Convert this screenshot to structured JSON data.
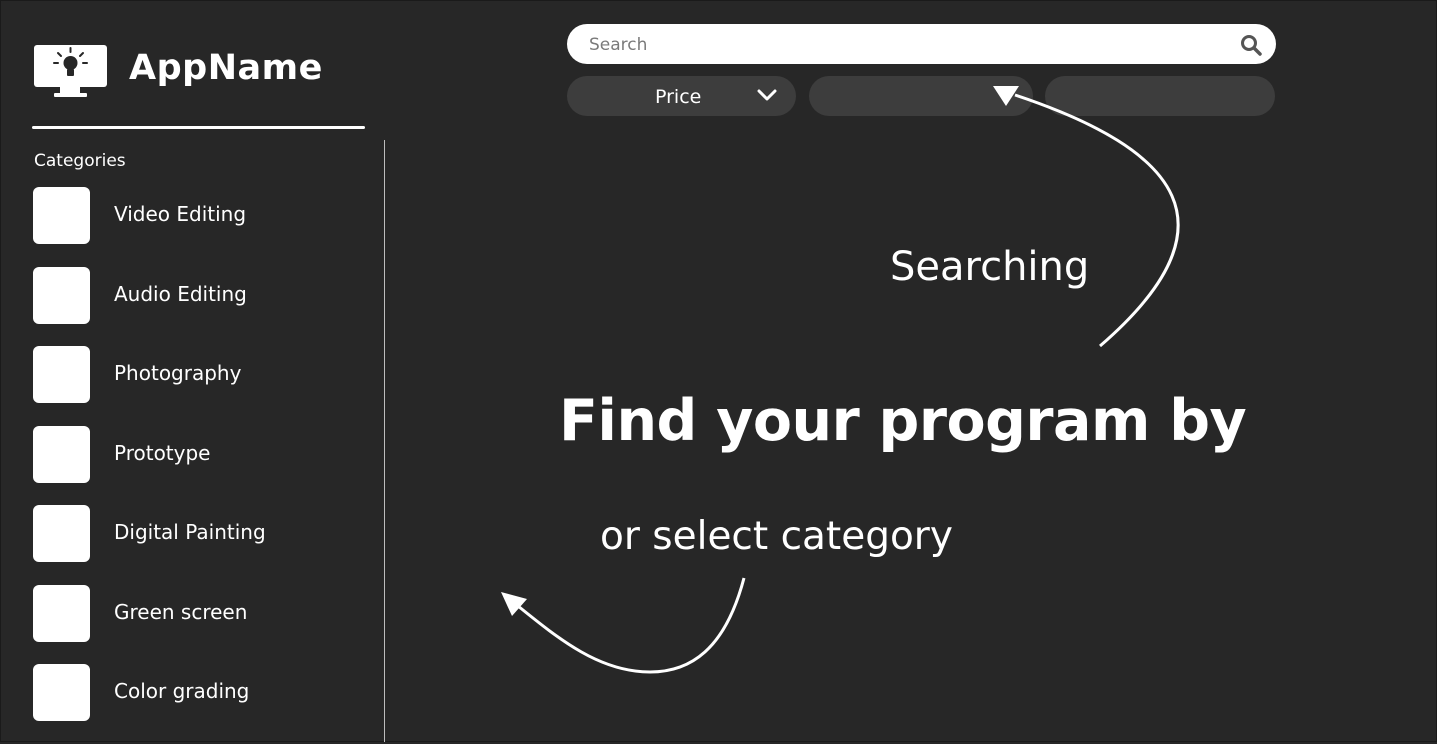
{
  "app": {
    "name": "AppName",
    "logo_icon": "monitor-lightbulb-icon"
  },
  "sidebar": {
    "heading": "Categories",
    "items": [
      {
        "label": "Video Editing"
      },
      {
        "label": "Audio Editing"
      },
      {
        "label": "Photography"
      },
      {
        "label": "Prototype"
      },
      {
        "label": "Digital Painting"
      },
      {
        "label": "Green screen"
      },
      {
        "label": "Color grading"
      }
    ]
  },
  "search": {
    "placeholder": "Search",
    "value": "",
    "icon": "search-icon"
  },
  "filters": [
    {
      "label": "Price",
      "icon": "chevron-down-icon"
    },
    {
      "label": ""
    },
    {
      "label": ""
    }
  ],
  "main": {
    "headline": "Find your program by",
    "searching_label": "Searching",
    "category_label": "or select category"
  },
  "colors": {
    "background": "#272727",
    "filter_pill": "#3d3d3d",
    "foreground": "#ffffff"
  }
}
